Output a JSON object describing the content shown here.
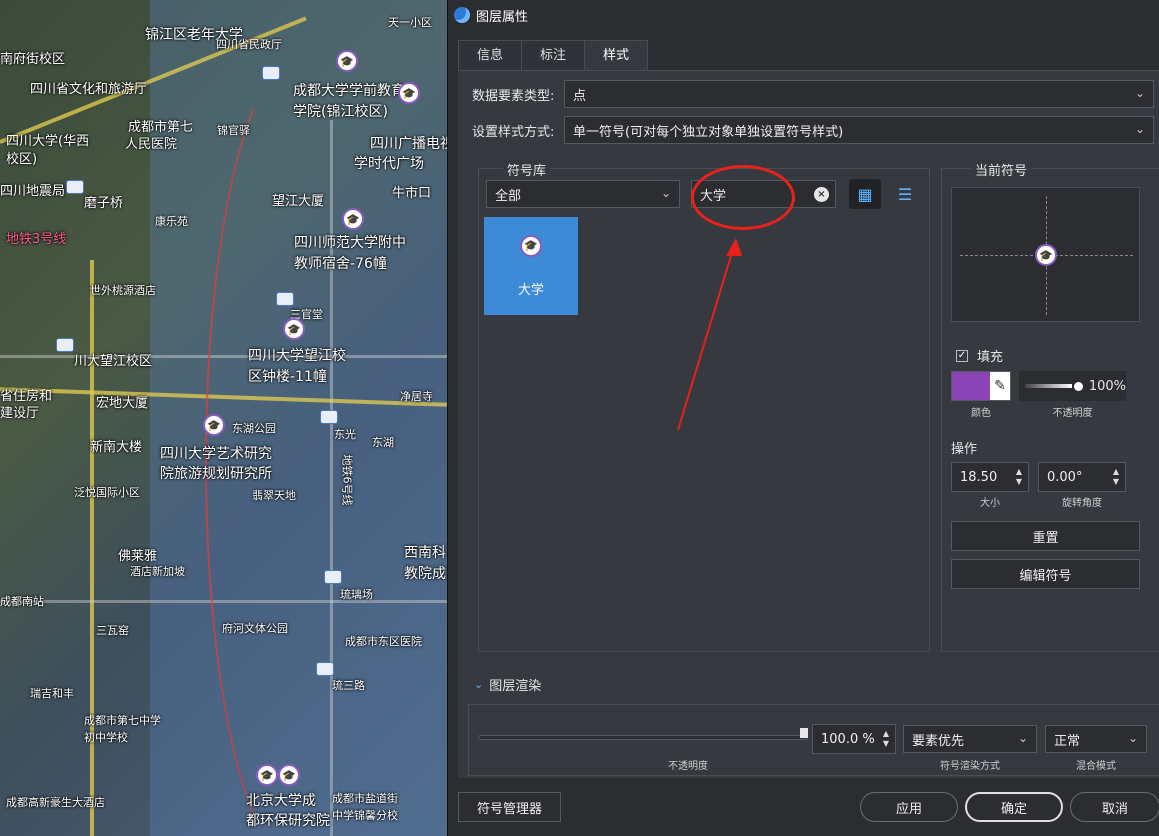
{
  "map": {
    "labels": [
      "锦江区老年大学",
      "四川省民政厅",
      "南府街校区",
      "四川省文化和旅游厅",
      "成都大学学前教育",
      "学院(锦江校区)",
      "成都市第七",
      "人民医院",
      "四川大学(华西",
      "校区)",
      "锦官驿",
      "四川广播电视",
      "学时代广场",
      "四川地震局",
      "望江大厦",
      "牛市口",
      "磨子桥",
      "地铁3号线",
      "四川师范大学附中",
      "教师宿舍-76幢",
      "康乐苑",
      "世外桃源酒店",
      "三官堂",
      "川大望江校区",
      "四川大学望江校",
      "区钟楼-11幢",
      "省住房和",
      "建设厅",
      "宏地大厦",
      "东湖公园",
      "净居寺",
      "新南大楼",
      "东光",
      "东湖",
      "四川大学艺术研究",
      "院旅游规划研究所",
      "泛悦国际小区",
      "翡翠天地",
      "佛莱雅",
      "酒店新加坡",
      "成都南站",
      "三瓦窑",
      "府河文体公园",
      "琉璃场",
      "西南科",
      "教院成",
      "成都市东区医院",
      "瑞吉和丰",
      "成都市第七中学",
      "初中学校",
      "琉三路",
      "北京大学成",
      "都环保研究院",
      "成都市盐道街",
      "中学锦馨分校",
      "成都高新豪生大酒店",
      "天一小区",
      "地铁6号线"
    ],
    "pin_icon": "graduation-cap-icon",
    "metro_icon": "metro-station-icon"
  },
  "dialog": {
    "title": "图层属性",
    "tabs": [
      {
        "label": "信息"
      },
      {
        "label": "标注"
      },
      {
        "label": "样式"
      }
    ],
    "feature_type_label": "数据要素类型:",
    "feature_type_value": "点",
    "style_mode_label": "设置样式方式:",
    "style_mode_value": "单一符号(可对每个独立对象单独设置符号样式)",
    "symbol_library": {
      "title": "符号库",
      "category_value": "全部",
      "search_value": "大学",
      "symbols": [
        {
          "label": "大学",
          "icon": "graduation-cap-icon"
        }
      ]
    },
    "current_symbol": {
      "title": "当前符号",
      "fill_label": "填充",
      "fill_checked": "✓",
      "color": "#8a44b5",
      "color_caption": "颜色",
      "opacity_value": "100%",
      "opacity_fraction": 1.0,
      "opacity_caption": "不透明度",
      "ops_label": "操作",
      "size_value": "18.50",
      "size_caption": "大小",
      "rotation_value": "0.00°",
      "rotation_caption": "旋转角度",
      "reset_label": "重置",
      "edit_label": "编辑符号"
    },
    "layer_render": {
      "title": "图层渲染",
      "opacity_value": "100.0 %",
      "opacity_fraction": 1.0,
      "opacity_caption": "不透明度",
      "render_mode_value": "要素优先",
      "render_mode_caption": "符号渲染方式",
      "blend_mode_value": "正常",
      "blend_mode_caption": "混合模式"
    },
    "footer": {
      "symbol_manager": "符号管理器",
      "apply": "应用",
      "ok": "确定",
      "cancel": "取消"
    }
  }
}
